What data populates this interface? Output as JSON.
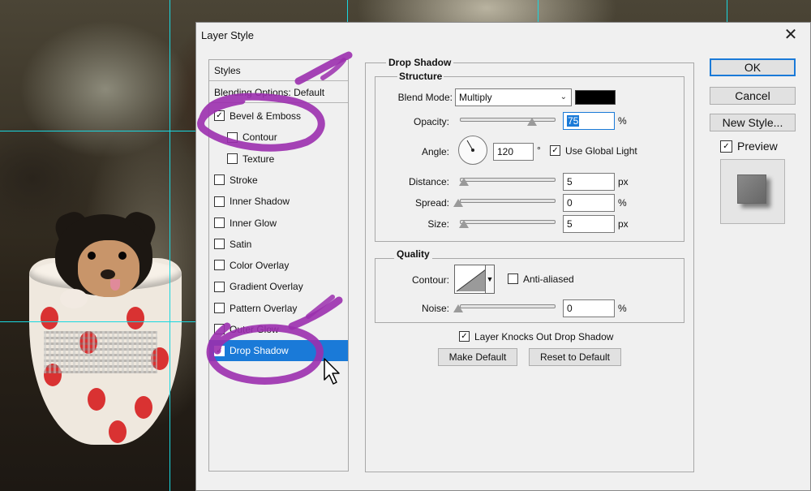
{
  "dialog": {
    "title": "Layer Style",
    "close_glyph": "✕"
  },
  "styles_panel": {
    "header": "Styles",
    "blending_options": "Blending Options: Default",
    "items": [
      {
        "label": "Bevel & Emboss",
        "checked": true,
        "indent": false
      },
      {
        "label": "Contour",
        "checked": false,
        "indent": true
      },
      {
        "label": "Texture",
        "checked": false,
        "indent": true
      },
      {
        "label": "Stroke",
        "checked": false,
        "indent": false
      },
      {
        "label": "Inner Shadow",
        "checked": false,
        "indent": false
      },
      {
        "label": "Inner Glow",
        "checked": false,
        "indent": false
      },
      {
        "label": "Satin",
        "checked": false,
        "indent": false
      },
      {
        "label": "Color Overlay",
        "checked": false,
        "indent": false
      },
      {
        "label": "Gradient Overlay",
        "checked": false,
        "indent": false
      },
      {
        "label": "Pattern Overlay",
        "checked": false,
        "indent": false
      },
      {
        "label": "Outer Glow",
        "checked": false,
        "indent": false
      },
      {
        "label": "Drop Shadow",
        "checked": true,
        "indent": false,
        "selected": true
      }
    ]
  },
  "drop_shadow": {
    "title": "Drop Shadow",
    "structure": {
      "title": "Structure",
      "blend_mode_label": "Blend Mode:",
      "blend_mode_value": "Multiply",
      "shadow_color": "#000000",
      "opacity_label": "Opacity:",
      "opacity_value": "75",
      "opacity_unit": "%",
      "opacity_level": 0.75,
      "angle_label": "Angle:",
      "angle_value": "120",
      "angle_unit": "°",
      "use_global_light_label": "Use Global Light",
      "use_global_light_checked": true,
      "distance_label": "Distance:",
      "distance_value": "5",
      "distance_unit": "px",
      "spread_label": "Spread:",
      "spread_value": "0",
      "spread_unit": "%",
      "size_label": "Size:",
      "size_value": "5",
      "size_unit": "px"
    },
    "quality": {
      "title": "Quality",
      "contour_label": "Contour:",
      "anti_aliased_label": "Anti-aliased",
      "anti_aliased_checked": false,
      "noise_label": "Noise:",
      "noise_value": "0",
      "noise_unit": "%"
    },
    "layer_knocks_out_label": "Layer Knocks Out Drop Shadow",
    "layer_knocks_out_checked": true,
    "make_default_label": "Make Default",
    "reset_default_label": "Reset to Default"
  },
  "buttons": {
    "ok": "OK",
    "cancel": "Cancel",
    "new_style": "New Style...",
    "preview_label": "Preview",
    "preview_checked": true
  },
  "colors": {
    "accent": "#1a7ad8",
    "guide": "#19d7e0",
    "annotation": "#9b2fae"
  },
  "check_glyph": "✓"
}
